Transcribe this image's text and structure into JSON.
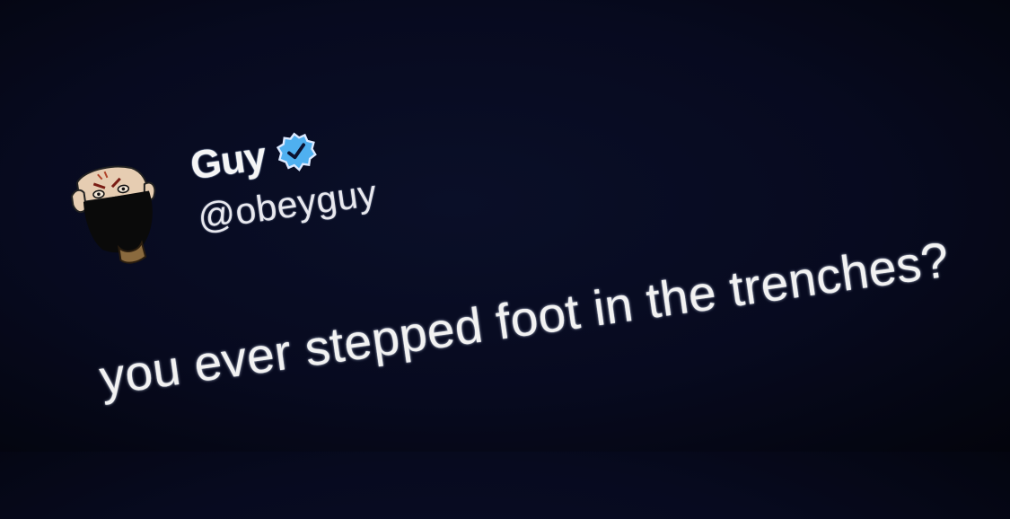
{
  "tweet": {
    "author": {
      "display_name": "Guy",
      "handle": "@obeyguy",
      "verified": true,
      "avatar_icon": "cartoon-masked-face-avatar",
      "badge_icon": "verified-badge-icon",
      "badge_color": "#4fb0f0"
    },
    "text": "you ever stepped foot in the trenches?"
  }
}
